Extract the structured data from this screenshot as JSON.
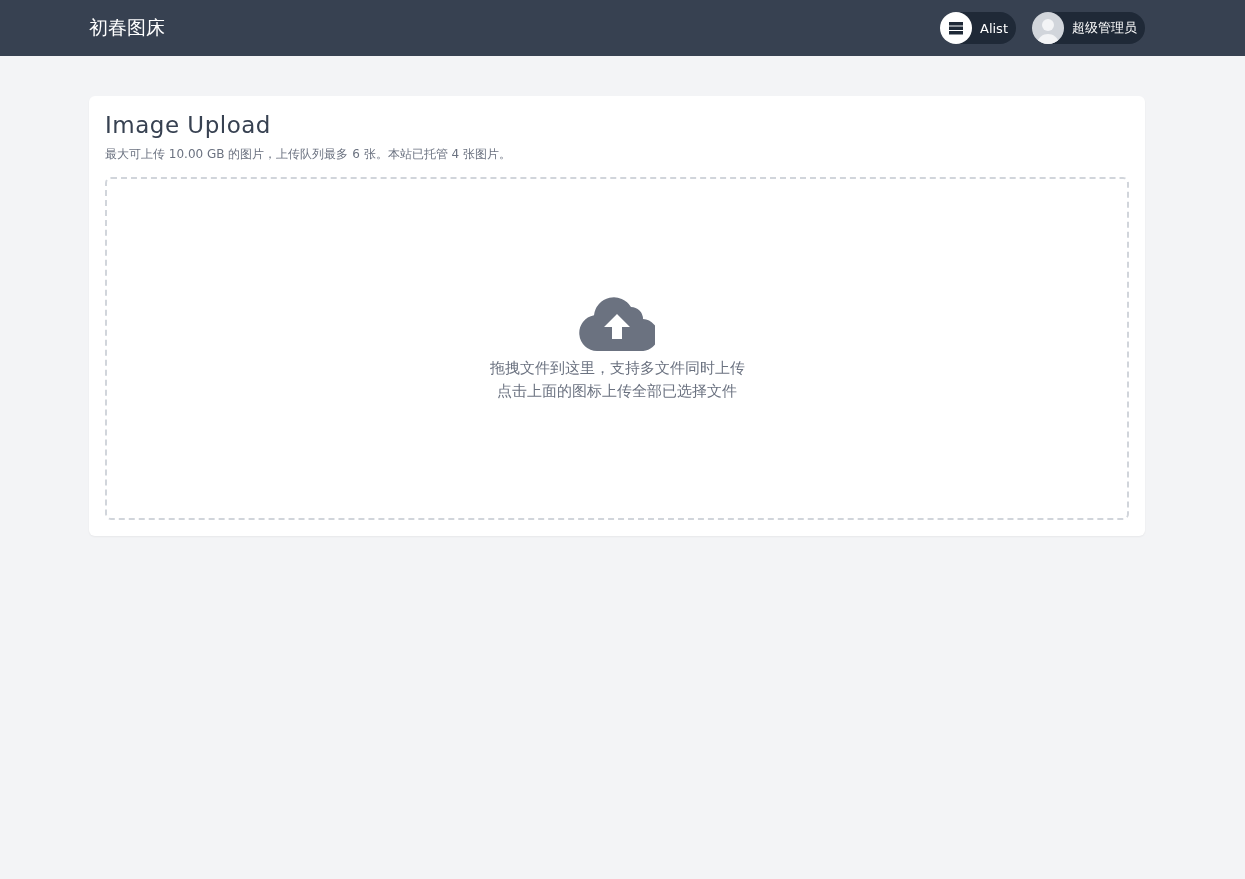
{
  "header": {
    "brand": "初春图床",
    "nav": [
      {
        "kind": "storage",
        "label": "Alist"
      },
      {
        "kind": "user",
        "label": "超级管理员"
      }
    ]
  },
  "upload": {
    "title": "Image Upload",
    "info": "最大可上传 10.00 GB 的图片，上传队列最多 6 张。本站已托管 4 张图片。",
    "hints": [
      "拖拽文件到这里，支持多文件同时上传",
      "点击上面的图标上传全部已选择文件"
    ]
  }
}
